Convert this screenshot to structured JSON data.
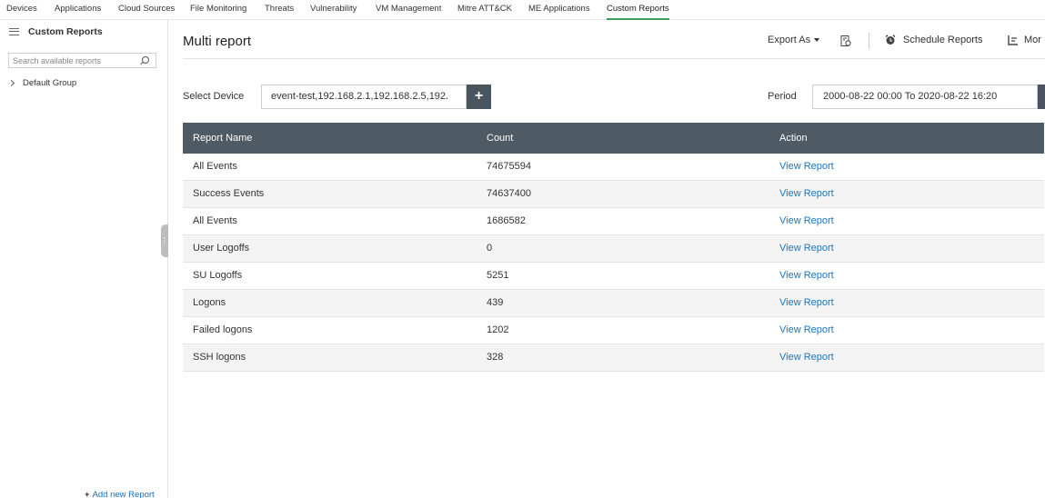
{
  "topnav": {
    "tabs": [
      {
        "label": "Devices"
      },
      {
        "label": "Applications"
      },
      {
        "label": "Cloud Sources"
      },
      {
        "label": "File Monitoring"
      },
      {
        "label": "Threats"
      },
      {
        "label": "Vulnerability"
      },
      {
        "label": "VM Management"
      },
      {
        "label": "Mitre ATT&CK"
      },
      {
        "label": "ME Applications"
      },
      {
        "label": "Custom Reports",
        "active": true
      }
    ]
  },
  "sidebar": {
    "title": "Custom Reports",
    "search_placeholder": "Search available reports",
    "group_label": "Default Group",
    "add_report_label": "Add new Report"
  },
  "header": {
    "title": "Multi report",
    "export_label": "Export As",
    "schedule_label": "Schedule Reports",
    "more_label": "Mor"
  },
  "filters": {
    "device_label": "Select Device",
    "device_value": "event-test,192.168.2.1,192.168.2.5,192.",
    "add_device_label": "+",
    "period_label": "Period",
    "period_value": "2000-08-22 00:00 To 2020-08-22 16:20"
  },
  "table": {
    "columns": [
      "Report Name",
      "Count",
      "Action"
    ],
    "rows": [
      {
        "name": "All Events",
        "count": "74675594",
        "action": "View Report"
      },
      {
        "name": "Success Events",
        "count": "74637400",
        "action": "View Report"
      },
      {
        "name": "All Events",
        "count": "1686582",
        "action": "View Report"
      },
      {
        "name": "User Logoffs",
        "count": "0",
        "action": "View Report"
      },
      {
        "name": "SU Logoffs",
        "count": "5251",
        "action": "View Report"
      },
      {
        "name": "Logons",
        "count": "439",
        "action": "View Report"
      },
      {
        "name": "Failed logons",
        "count": "1202",
        "action": "View Report"
      },
      {
        "name": "SSH logons",
        "count": "328",
        "action": "View Report"
      }
    ]
  },
  "colors": {
    "table_header_bg": "#4e5a64",
    "link": "#1a76c0",
    "active_tab_underline": "#3aa15a"
  }
}
